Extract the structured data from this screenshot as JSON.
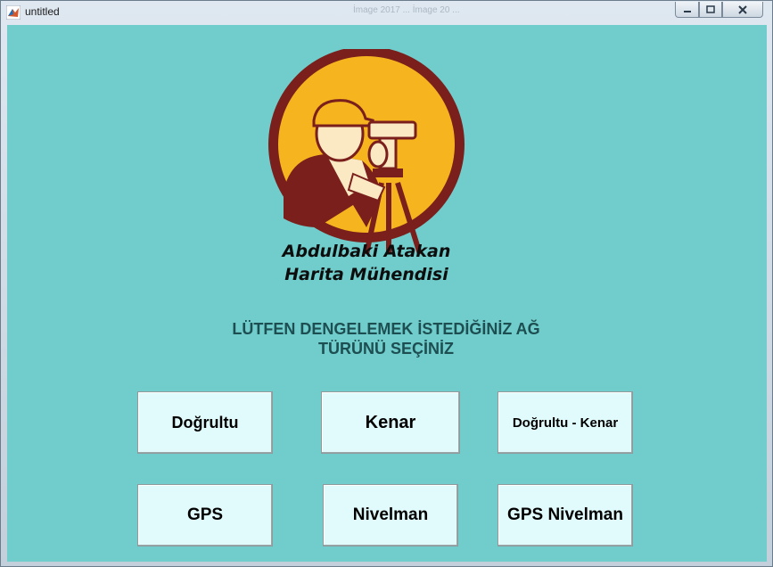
{
  "window": {
    "title": "untitled",
    "background_title": "İmage 2017 ... İmage 20 ..."
  },
  "logo": {
    "name_line1": "Abdulbaki Atakan",
    "name_line2": "Harita Mühendisi"
  },
  "prompt": {
    "line1": "LÜTFEN DENGELEMEK İSTEDİĞİNİZ AĞ",
    "line2": "TÜRÜNÜ SEÇİNİZ"
  },
  "buttons": {
    "dogrultu": "Doğrultu",
    "kenar": "Kenar",
    "dogrultu_kenar": "Doğrultu - Kenar",
    "gps": "GPS",
    "nivelman": "Nivelman",
    "gps_nivelman": "GPS Nivelman"
  },
  "colors": {
    "background": "#71cdcc",
    "button_face": "#e1fafb",
    "prompt_text": "#1d4e51",
    "logo_ring": "#7a1f1c",
    "logo_fill": "#f6b51e"
  }
}
